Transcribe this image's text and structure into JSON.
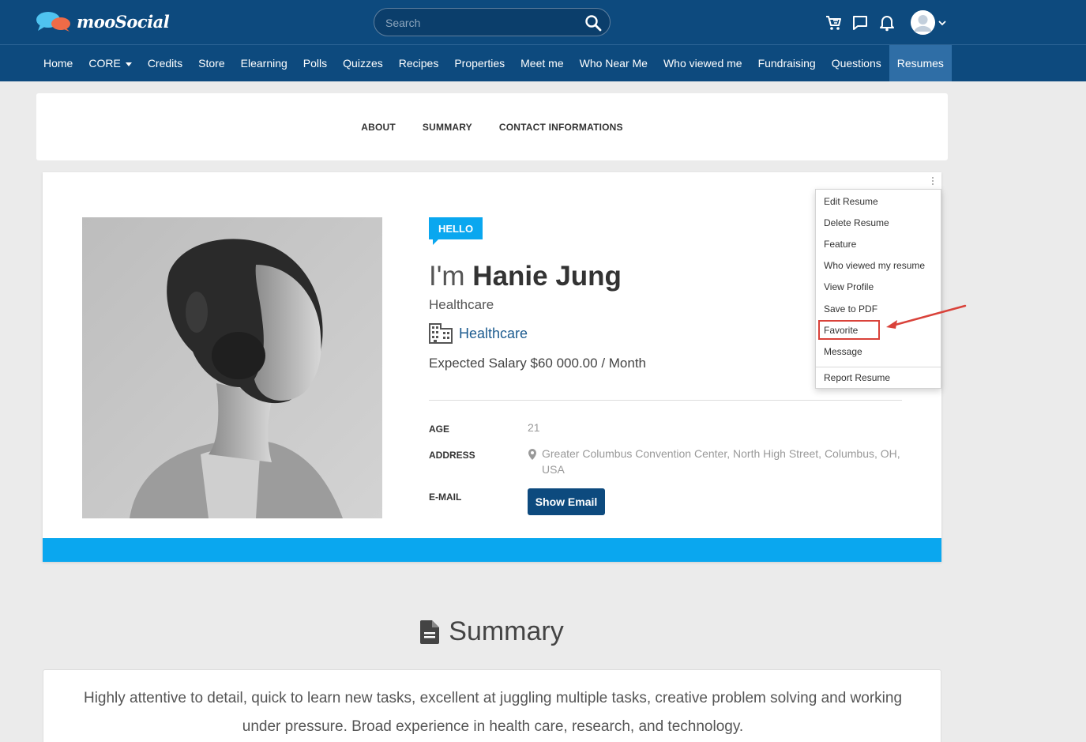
{
  "header": {
    "logo_text": "mooSocial",
    "search_placeholder": "Search"
  },
  "nav": {
    "items": [
      "Home",
      "CORE",
      "Credits",
      "Store",
      "Elearning",
      "Polls",
      "Quizzes",
      "Recipes",
      "Properties",
      "Meet me",
      "Who Near Me",
      "Who viewed me",
      "Fundraising",
      "Questions",
      "Resumes"
    ],
    "active": "Resumes"
  },
  "tabs": [
    "ABOUT",
    "SUMMARY",
    "CONTACT INFORMATIONS"
  ],
  "profile": {
    "badge": "HELLO",
    "name_prefix": "I'm",
    "name": "Hanie Jung",
    "job_title": "Healthcare",
    "industry": "Healthcare",
    "salary": "Expected Salary $60 000.00 / Month",
    "age_label": "AGE",
    "age_value": "21",
    "address_label": "ADDRESS",
    "address_value": "Greater Columbus Convention Center, North High Street, Columbus, OH, USA",
    "email_label": "E-MAIL",
    "show_email_button": "Show Email"
  },
  "menu": {
    "items": [
      "Edit Resume",
      "Delete Resume",
      "Feature",
      "Who viewed my resume",
      "View Profile",
      "Save to PDF",
      "Favorite",
      "Message"
    ],
    "report": "Report Resume",
    "highlighted": "Favorite"
  },
  "summary": {
    "heading": "Summary",
    "text": "Highly attentive to detail, quick to learn new tasks, excellent at juggling multiple tasks, creative problem solving and working under pressure. Broad experience in health care, research, and technology."
  },
  "colors": {
    "header_bg": "#0d4a7e",
    "nav_active_bg": "#2f6ea6",
    "accent": "#0aa7ef",
    "link": "#1c5b8f",
    "highlight": "#d9423a"
  },
  "icons": {
    "search": "search-icon",
    "cart": "cart-icon",
    "chat": "chat-icon",
    "bell": "bell-icon",
    "user": "user-avatar-icon",
    "building": "building-icon",
    "pin": "map-pin-icon",
    "document": "document-icon",
    "kebab": "more-vertical-icon"
  }
}
